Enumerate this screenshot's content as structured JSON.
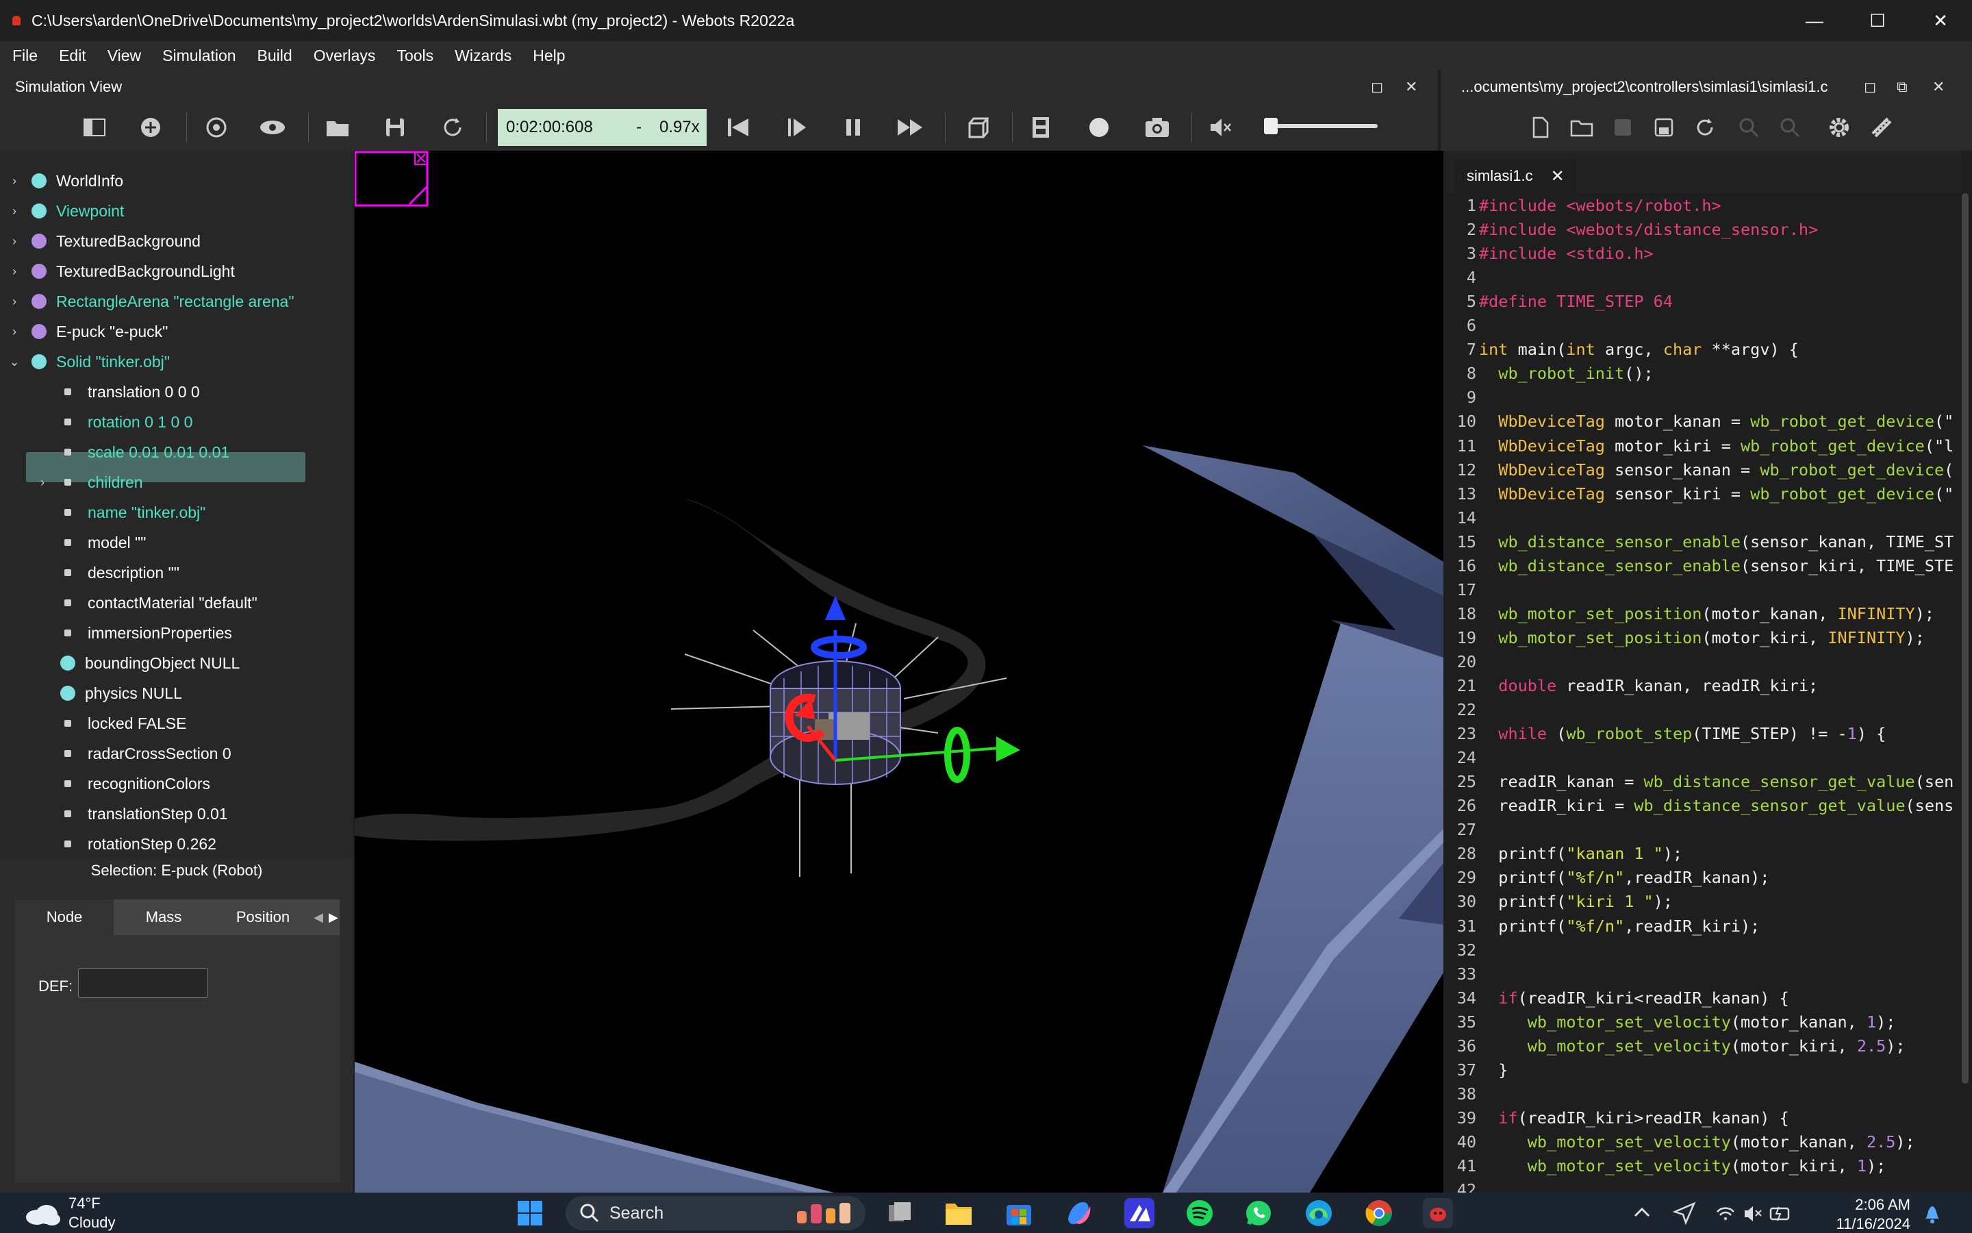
{
  "window": {
    "title": "C:\\Users\\arden\\OneDrive\\Documents\\my_project2\\worlds\\ArdenSimulasi.wbt (my_project2) - Webots R2022a",
    "minimize": "—",
    "maximize": "☐",
    "close": "✕"
  },
  "menu": [
    "File",
    "Edit",
    "View",
    "Simulation",
    "Build",
    "Overlays",
    "Tools",
    "Wizards",
    "Help"
  ],
  "sim_view": {
    "label": "Simulation View",
    "time": "0:02:00:608",
    "separator": "-",
    "speed": "0.97x",
    "float_icon": "◻",
    "close_icon": "✕"
  },
  "editor": {
    "path_label": "...ocuments\\my_project2\\controllers\\simlasi1\\simlasi1.c",
    "tab_label": "simlasi1.c",
    "tab_close": "✕",
    "float_icon": "◻",
    "restore_icon": "⧉",
    "close_icon": "✕"
  },
  "tree": {
    "items": [
      {
        "arrow": "›",
        "label": "WorldInfo",
        "dot": "#7fe0e0",
        "color": "white"
      },
      {
        "arrow": "›",
        "label": "Viewpoint",
        "dot": "#7fe0e0",
        "color": "cyan"
      },
      {
        "arrow": "›",
        "label": "TexturedBackground",
        "dot": "#b48ae0",
        "color": "white"
      },
      {
        "arrow": "›",
        "label": "TexturedBackgroundLight",
        "dot": "#b48ae0",
        "color": "white"
      },
      {
        "arrow": "›",
        "label": "RectangleArena \"rectangle arena\"",
        "dot": "#b48ae0",
        "color": "cyan"
      },
      {
        "arrow": "›",
        "label": "E-puck \"e-puck\"",
        "dot": "#b48ae0",
        "color": "white"
      },
      {
        "arrow": "⌄",
        "label": "Solid \"tinker.obj\"",
        "dot": "#7fe0e0",
        "color": "cyan"
      }
    ],
    "fields": [
      {
        "label": "translation 0 0 0",
        "color": "white",
        "arrow": ""
      },
      {
        "label": "rotation 0 1 0 0",
        "color": "cyan",
        "arrow": ""
      },
      {
        "label": "scale 0.01 0.01 0.01",
        "color": "cyan",
        "arrow": ""
      },
      {
        "label": "children",
        "color": "cyan",
        "arrow": "›"
      },
      {
        "label": "name \"tinker.obj\"",
        "color": "cyan",
        "arrow": ""
      },
      {
        "label": "model \"\"",
        "color": "white",
        "arrow": ""
      },
      {
        "label": "description \"\"",
        "color": "white",
        "arrow": ""
      },
      {
        "label": "contactMaterial \"default\"",
        "color": "white",
        "arrow": ""
      },
      {
        "label": "immersionProperties",
        "color": "white",
        "arrow": ""
      }
    ],
    "null_fields": [
      {
        "label": "boundingObject NULL"
      },
      {
        "label": "physics NULL"
      }
    ],
    "fields2": [
      {
        "label": "locked FALSE"
      },
      {
        "label": "radarCrossSection 0"
      },
      {
        "label": "recognitionColors"
      },
      {
        "label": "translationStep 0.01"
      },
      {
        "label": "rotationStep 0.262"
      }
    ]
  },
  "selection": "Selection: E-puck (Robot)",
  "field_tabs": [
    "Node",
    "Mass",
    "Position"
  ],
  "tab_arrows": {
    "left": "◀",
    "right": "▶"
  },
  "def_label": "DEF:",
  "def_value": "",
  "code_lines": [
    [
      [
        "pp",
        "#include <webots/robot.h>"
      ]
    ],
    [
      [
        "pp",
        "#include <webots/distance_sensor.h>"
      ]
    ],
    [
      [
        "pp",
        "#include <stdio.h>"
      ]
    ],
    [],
    [
      [
        "pp",
        "#define TIME_STEP 64"
      ]
    ],
    [],
    [
      [
        "ty",
        "int"
      ],
      [
        "df",
        " main("
      ],
      [
        "ty",
        "int"
      ],
      [
        "df",
        " argc, "
      ],
      [
        "ty",
        "char"
      ],
      [
        "df",
        " **argv) {"
      ]
    ],
    [
      [
        "df",
        "  "
      ],
      [
        "fn",
        "wb_robot_init"
      ],
      [
        "df",
        "();"
      ]
    ],
    [],
    [
      [
        "df",
        "  "
      ],
      [
        "ty",
        "WbDeviceTag"
      ],
      [
        "df",
        " motor_kanan = "
      ],
      [
        "fn",
        "wb_robot_get_device"
      ],
      [
        "df",
        "(\""
      ]
    ],
    [
      [
        "df",
        "  "
      ],
      [
        "ty",
        "WbDeviceTag"
      ],
      [
        "df",
        " motor_kiri = "
      ],
      [
        "fn",
        "wb_robot_get_device"
      ],
      [
        "df",
        "(\"l"
      ]
    ],
    [
      [
        "df",
        "  "
      ],
      [
        "ty",
        "WbDeviceTag"
      ],
      [
        "df",
        " sensor_kanan = "
      ],
      [
        "fn",
        "wb_robot_get_device"
      ],
      [
        "df",
        "("
      ]
    ],
    [
      [
        "df",
        "  "
      ],
      [
        "ty",
        "WbDeviceTag"
      ],
      [
        "df",
        " sensor_kiri = "
      ],
      [
        "fn",
        "wb_robot_get_device"
      ],
      [
        "df",
        "(\""
      ]
    ],
    [],
    [
      [
        "df",
        "  "
      ],
      [
        "fn",
        "wb_distance_sensor_enable"
      ],
      [
        "df",
        "(sensor_kanan, TIME_ST"
      ]
    ],
    [
      [
        "df",
        "  "
      ],
      [
        "fn",
        "wb_distance_sensor_enable"
      ],
      [
        "df",
        "(sensor_kiri, TIME_STE"
      ]
    ],
    [],
    [
      [
        "df",
        "  "
      ],
      [
        "fn",
        "wb_motor_set_position"
      ],
      [
        "df",
        "(motor_kanan, "
      ],
      [
        "ty",
        "INFINITY"
      ],
      [
        "df",
        ");"
      ]
    ],
    [
      [
        "df",
        "  "
      ],
      [
        "fn",
        "wb_motor_set_position"
      ],
      [
        "df",
        "(motor_kiri, "
      ],
      [
        "ty",
        "INFINITY"
      ],
      [
        "df",
        ");"
      ]
    ],
    [],
    [
      [
        "df",
        "  "
      ],
      [
        "kw",
        "double"
      ],
      [
        "df",
        " readIR_kanan, readIR_kiri;"
      ]
    ],
    [],
    [
      [
        "df",
        "  "
      ],
      [
        "kw",
        "while"
      ],
      [
        "df",
        " ("
      ],
      [
        "fn",
        "wb_robot_step"
      ],
      [
        "df",
        "(TIME_STEP) != -"
      ],
      [
        "nu",
        "1"
      ],
      [
        "df",
        ") {"
      ]
    ],
    [],
    [
      [
        "df",
        "  readIR_kanan = "
      ],
      [
        "fn",
        "wb_distance_sensor_get_value"
      ],
      [
        "df",
        "(sen"
      ]
    ],
    [
      [
        "df",
        "  readIR_kiri = "
      ],
      [
        "fn",
        "wb_distance_sensor_get_value"
      ],
      [
        "df",
        "(sens"
      ]
    ],
    [],
    [
      [
        "df",
        "  printf("
      ],
      [
        "st",
        "\"kanan 1 \""
      ],
      [
        "df",
        ");"
      ]
    ],
    [
      [
        "df",
        "  printf("
      ],
      [
        "st",
        "\"%f/n\""
      ],
      [
        "df",
        ",readIR_kanan);"
      ]
    ],
    [
      [
        "df",
        "  printf("
      ],
      [
        "st",
        "\"kiri 1 \""
      ],
      [
        "df",
        ");"
      ]
    ],
    [
      [
        "df",
        "  printf("
      ],
      [
        "st",
        "\"%f/n\""
      ],
      [
        "df",
        ",readIR_kiri);"
      ]
    ],
    [],
    [],
    [
      [
        "df",
        "  "
      ],
      [
        "kw",
        "if"
      ],
      [
        "df",
        "(readIR_kiri<readIR_kanan) {"
      ]
    ],
    [
      [
        "df",
        "     "
      ],
      [
        "fn",
        "wb_motor_set_velocity"
      ],
      [
        "df",
        "(motor_kanan, "
      ],
      [
        "nu",
        "1"
      ],
      [
        "df",
        ");"
      ]
    ],
    [
      [
        "df",
        "     "
      ],
      [
        "fn",
        "wb_motor_set_velocity"
      ],
      [
        "df",
        "(motor_kiri, "
      ],
      [
        "nu",
        "2.5"
      ],
      [
        "df",
        ");"
      ]
    ],
    [
      [
        "df",
        "  }"
      ]
    ],
    [],
    [
      [
        "df",
        "  "
      ],
      [
        "kw",
        "if"
      ],
      [
        "df",
        "(readIR_kiri>readIR_kanan) {"
      ]
    ],
    [
      [
        "df",
        "     "
      ],
      [
        "fn",
        "wb_motor_set_velocity"
      ],
      [
        "df",
        "(motor_kanan, "
      ],
      [
        "nu",
        "2.5"
      ],
      [
        "df",
        ");"
      ]
    ],
    [
      [
        "df",
        "     "
      ],
      [
        "fn",
        "wb_motor_set_velocity"
      ],
      [
        "df",
        "(motor_kiri, "
      ],
      [
        "nu",
        "1"
      ],
      [
        "df",
        ");"
      ]
    ],
    [],
    [
      [
        "df",
        "  }"
      ]
    ],
    [],
    [
      [
        "df",
        "  };"
      ]
    ]
  ],
  "taskbar": {
    "temp": "74°F",
    "condition": "Cloudy",
    "search": "Search",
    "time": "2:06 AM",
    "date": "11/16/2024"
  },
  "colors": {
    "accent_time": "#c8e6d0",
    "selection": "#4b6b66",
    "cyan_text": "#4ee0c2"
  }
}
